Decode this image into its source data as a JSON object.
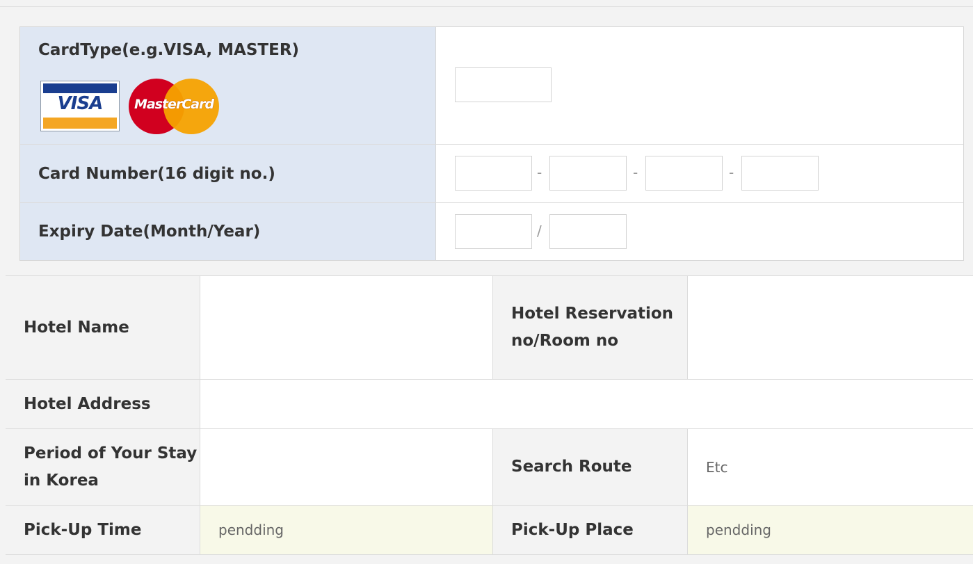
{
  "card": {
    "card_type_label": "CardType(e.g.VISA, MASTER)",
    "visa_logo": "VISA",
    "mastercard_logo": "MasterCard",
    "card_number_label": "Card Number(16 digit no.)",
    "card_number_sep": "-",
    "expiry_label": "Expiry Date(Month/Year)",
    "expiry_sep": "/"
  },
  "hotel": {
    "name_label": "Hotel Name",
    "reservation_label": "Hotel Reservation no/Room no",
    "address_label": "Hotel Address",
    "period_label": "Period of Your Stay in Korea",
    "search_route_label": "Search Route",
    "search_route_value": "Etc",
    "pickup_time_label": "Pick-Up Time",
    "pickup_time_value": "pendding",
    "pickup_place_label": "Pick-Up Place",
    "pickup_place_value": "pendding"
  },
  "colors": {
    "label_bg_blue": "#dfe7f3",
    "label_bg_gray": "#f3f3f3",
    "highlight_bg": "#f8f9e8"
  }
}
